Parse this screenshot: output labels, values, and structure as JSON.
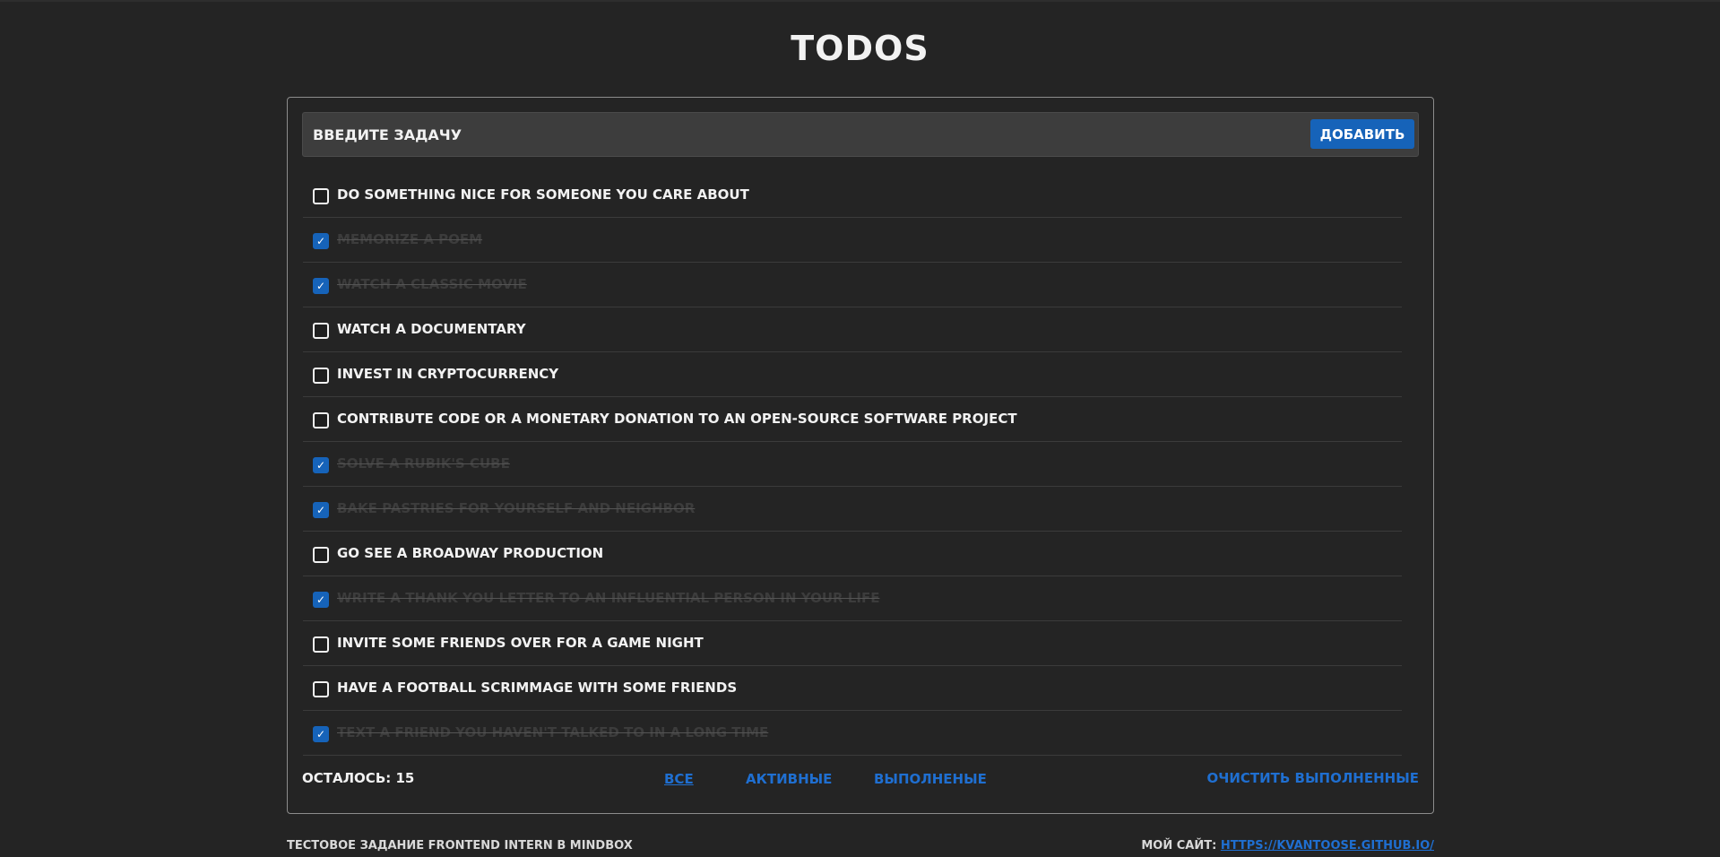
{
  "app": {
    "title": "todos"
  },
  "input": {
    "placeholder": "Введите задачу",
    "value": ""
  },
  "add_button": {
    "label": "Добавить"
  },
  "todos": [
    {
      "label": "Do something nice for someone you care about",
      "completed": false
    },
    {
      "label": "Memorize a poem",
      "completed": true
    },
    {
      "label": "Watch a classic movie",
      "completed": true
    },
    {
      "label": "Watch a documentary",
      "completed": false
    },
    {
      "label": "Invest in cryptocurrency",
      "completed": false
    },
    {
      "label": "Contribute code or a monetary donation to an open-source software project",
      "completed": false
    },
    {
      "label": "Solve a Rubik's cube",
      "completed": true
    },
    {
      "label": "Bake pastries for yourself and neighbor",
      "completed": true
    },
    {
      "label": "Go see a Broadway production",
      "completed": false
    },
    {
      "label": "Write a thank you letter to an influential person in your life",
      "completed": true
    },
    {
      "label": "Invite some friends over for a game night",
      "completed": false
    },
    {
      "label": "Have a football scrimmage with some friends",
      "completed": false
    },
    {
      "label": "Text a friend you haven't talked to in a long time",
      "completed": true
    }
  ],
  "footer_bar": {
    "counter": "Осталось: 15",
    "filters": [
      {
        "label": "Все",
        "active": true
      },
      {
        "label": "Активные",
        "active": false
      },
      {
        "label": "Выполненые",
        "active": false
      }
    ],
    "clear_label": "Очистить выполненные"
  },
  "page_footer": {
    "left_text": "Тестовое задание Frontend Intern в Mindbox",
    "site_label": "Мой сайт:",
    "site_link": "https://kvantoose.github.io/"
  },
  "colors": {
    "background": "#242424",
    "accent": "#1663b9",
    "link": "#1f6fd1",
    "text": "#f2f2f2",
    "completed_text": "#3c3c3c"
  }
}
